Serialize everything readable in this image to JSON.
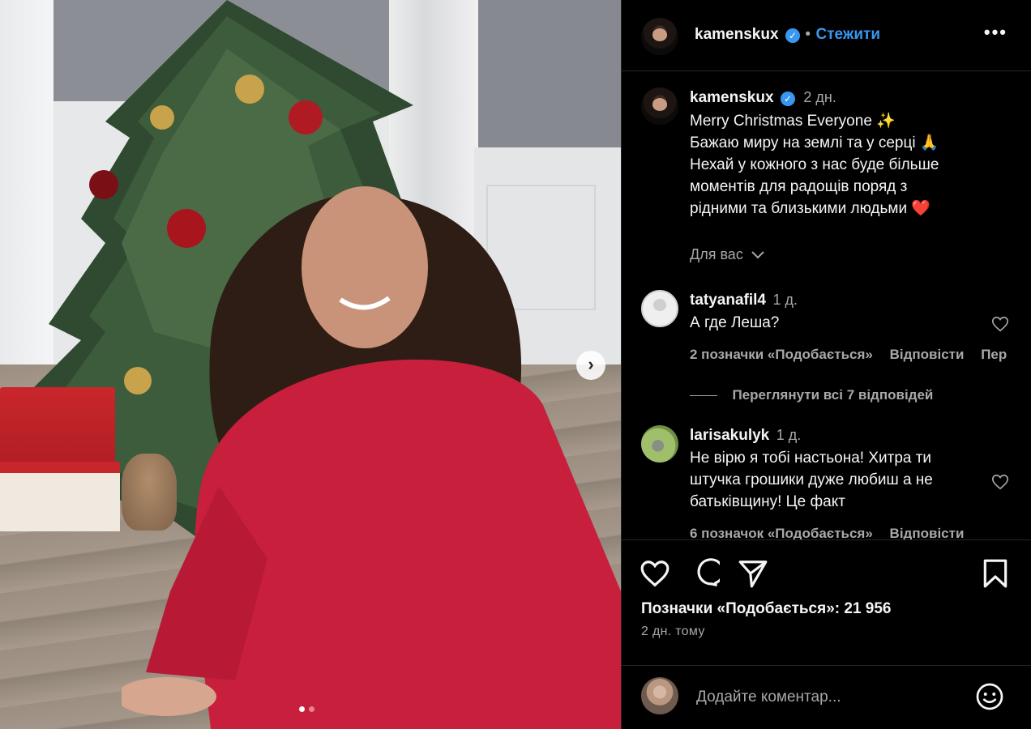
{
  "author": {
    "username": "kamenskux",
    "follow_label": "Стежити",
    "caption_time": "2 дн."
  },
  "caption": {
    "lines": [
      "Merry Christmas Everyone ✨",
      "Бажаю миру на землі та у серці 🙏",
      "Нехай у кожного з нас буде більше",
      "моментів для радощів поряд з",
      "рідними та близькими людьми ❤️"
    ]
  },
  "translation_toggle": {
    "label": "Для вас"
  },
  "comments": [
    {
      "username": "tatyanafil4",
      "time": "1 д.",
      "text_lines": [
        "А где Леша?"
      ],
      "likes_label": "2 позначки «Подобається»",
      "reply_label": "Відповісти",
      "extra_label": "Пер"
    },
    {
      "username": "larisakulyk",
      "time": "1 д.",
      "text_lines": [
        "Не вірю я тобі настьона! Хитра ти",
        "штучка грошики дуже любиш а не",
        "батьківщину! Це факт"
      ],
      "likes_label": "6 позначок «Подобається»",
      "reply_label": "Відповісти"
    }
  ],
  "view_replies_label": "Переглянути всі 7 відповідей",
  "likes_total": "Позначки «Подобається»: 21 956",
  "posted_ago": "2 дн. тому",
  "composer": {
    "placeholder": "Додайте коментар..."
  },
  "carousel": {
    "slide_count": 2,
    "active_index": 0
  },
  "icons": {
    "like": "heart-icon",
    "comment": "comment-bubble-icon",
    "share": "paper-plane-icon",
    "save": "bookmark-icon",
    "more": "ellipsis-icon",
    "verified": "verified-badge-icon",
    "next": "chevron-right-icon",
    "emoji": "smiley-icon"
  },
  "colors": {
    "background": "#000000",
    "text": "#f5f5f5",
    "muted": "#a8a8a8",
    "accent": "#3897f0",
    "divider": "#262626"
  }
}
